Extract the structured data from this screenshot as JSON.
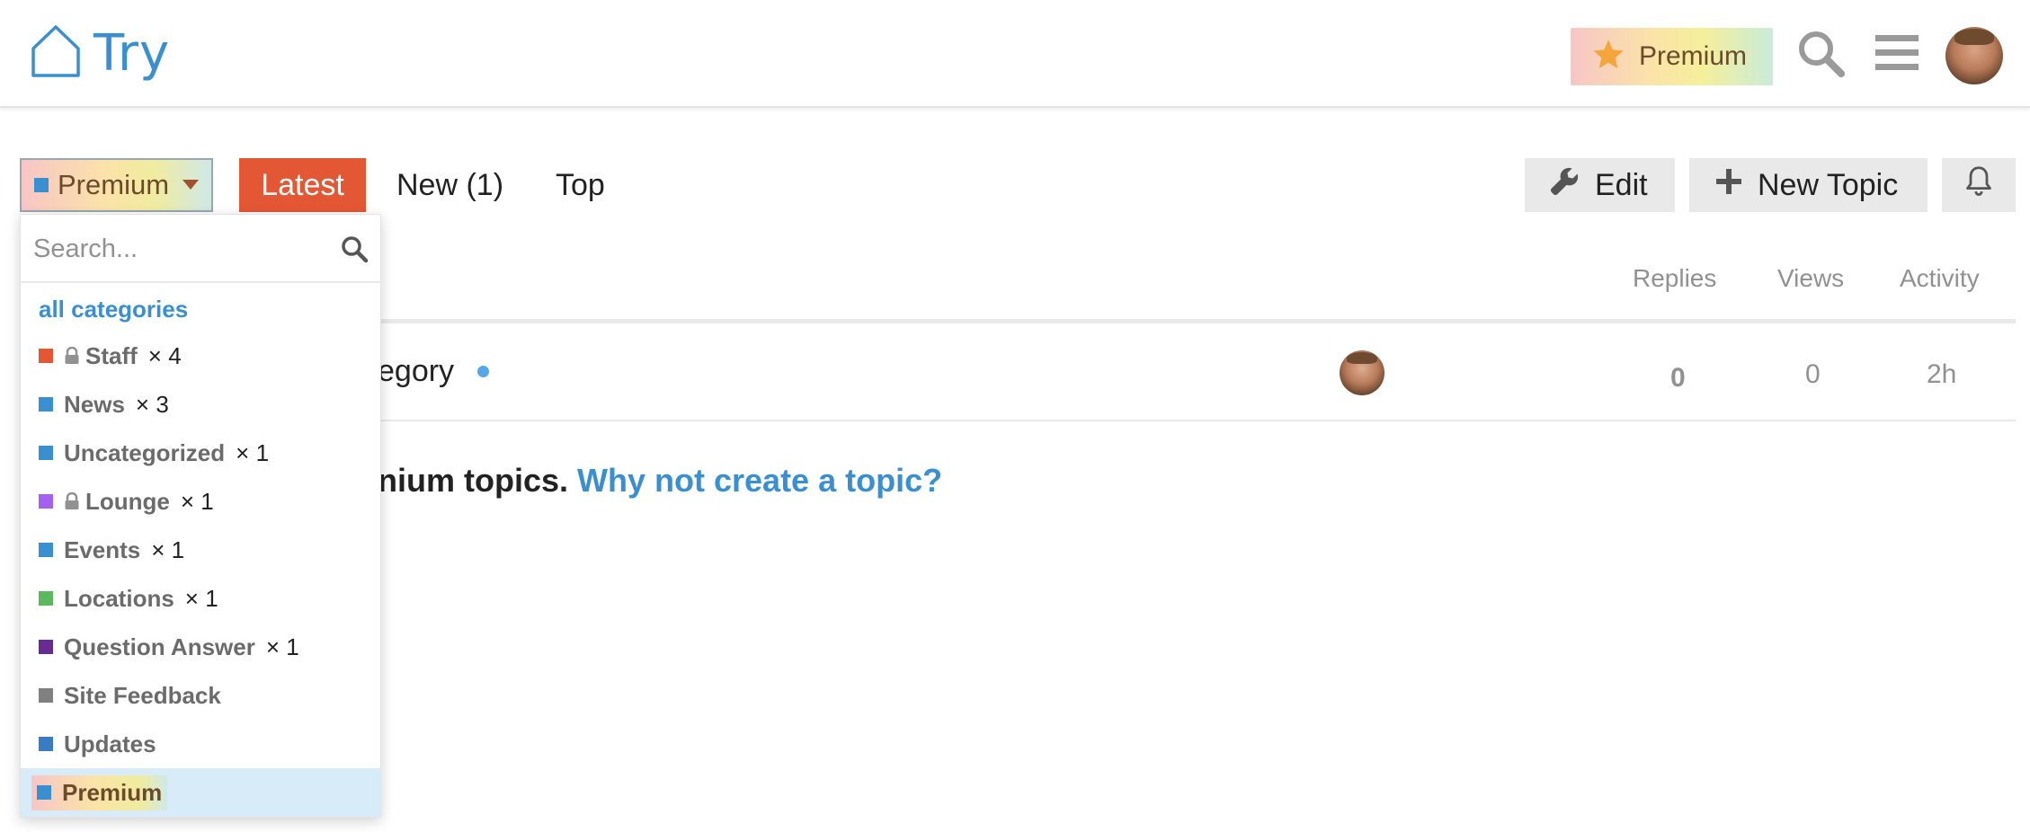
{
  "header": {
    "site_title": "Try",
    "premium_badge_label": "Premium",
    "icons": [
      "home-icon",
      "star-icon",
      "search-icon",
      "hamburger-menu-icon",
      "user-avatar"
    ]
  },
  "nav": {
    "category_selector": {
      "label": "Premium",
      "color": "#3a8fd0"
    },
    "tabs": [
      {
        "label": "Latest",
        "active": true
      },
      {
        "label": "New (1)",
        "active": false
      },
      {
        "label": "Top",
        "active": false
      }
    ],
    "edit_label": "Edit",
    "new_topic_label": "New Topic"
  },
  "dropdown": {
    "search_placeholder": "Search...",
    "all_categories_label": "all categories",
    "categories": [
      {
        "name": "Staff",
        "count": "× 4",
        "color": "#e45735",
        "locked": true
      },
      {
        "name": "News",
        "count": "× 3",
        "color": "#3a8fd0",
        "locked": false
      },
      {
        "name": "Uncategorized",
        "count": "× 1",
        "color": "#3a8fd0",
        "locked": false
      },
      {
        "name": "Lounge",
        "count": "× 1",
        "color": "#a461ef",
        "locked": true
      },
      {
        "name": "Events",
        "count": "× 1",
        "color": "#3a8fd0",
        "locked": false
      },
      {
        "name": "Locations",
        "count": "× 1",
        "color": "#5cb85c",
        "locked": false
      },
      {
        "name": "Question Answer",
        "count": "× 1",
        "color": "#652d90",
        "locked": false
      },
      {
        "name": "Site Feedback",
        "count": "",
        "color": "#808080",
        "locked": false
      },
      {
        "name": "Updates",
        "count": "",
        "color": "#3a7cc1",
        "locked": false
      },
      {
        "name": "Premium",
        "count": "",
        "color": "#3a8fd0",
        "locked": false,
        "selected": true
      }
    ]
  },
  "topic_list": {
    "columns": {
      "replies": "Replies",
      "views": "Views",
      "activity": "Activity"
    },
    "rows": [
      {
        "title_visible": "egory",
        "replies": "0",
        "views": "0",
        "activity": "2h"
      }
    ],
    "footer_text": "nium topics.",
    "footer_link": "Why not create a topic?"
  },
  "colors": {
    "accent": "#e45735",
    "link": "#3a8fd0",
    "muted": "#919191"
  }
}
